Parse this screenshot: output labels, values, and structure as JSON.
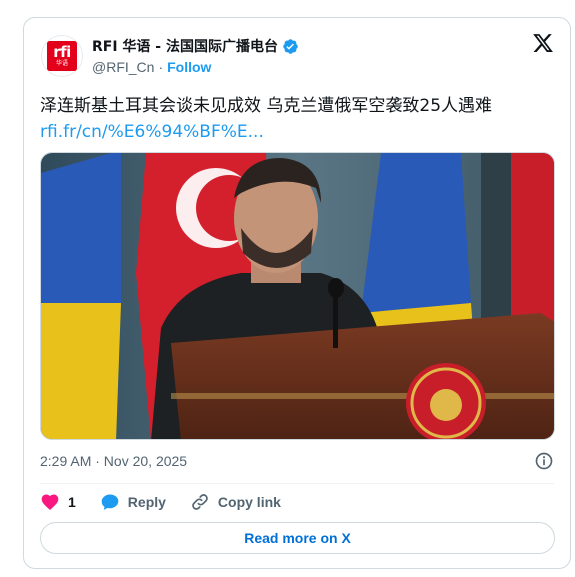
{
  "author": {
    "display_name": "RFI 华语 - 法国国际广播电台",
    "handle": "@RFI_Cn",
    "dot": "·",
    "follow_label": "Follow",
    "logo_text": "rfi",
    "logo_sub": "华语"
  },
  "tweet": {
    "text": "泽连斯基土耳其会谈未见成效 乌克兰遭俄军空袭致25人遇难 ",
    "link": "rfi.fr/cn/%E6%94%BF%E..."
  },
  "meta": {
    "timestamp": "2:29 AM · Nov 20, 2025"
  },
  "actions": {
    "like_count": "1",
    "reply_label": "Reply",
    "copy_label": "Copy link"
  },
  "read_more_label": "Read more on X",
  "colors": {
    "accent": "#1d9bf0",
    "like": "#f91880",
    "link_button": "#006fd6",
    "logo_red": "#e2001a"
  }
}
